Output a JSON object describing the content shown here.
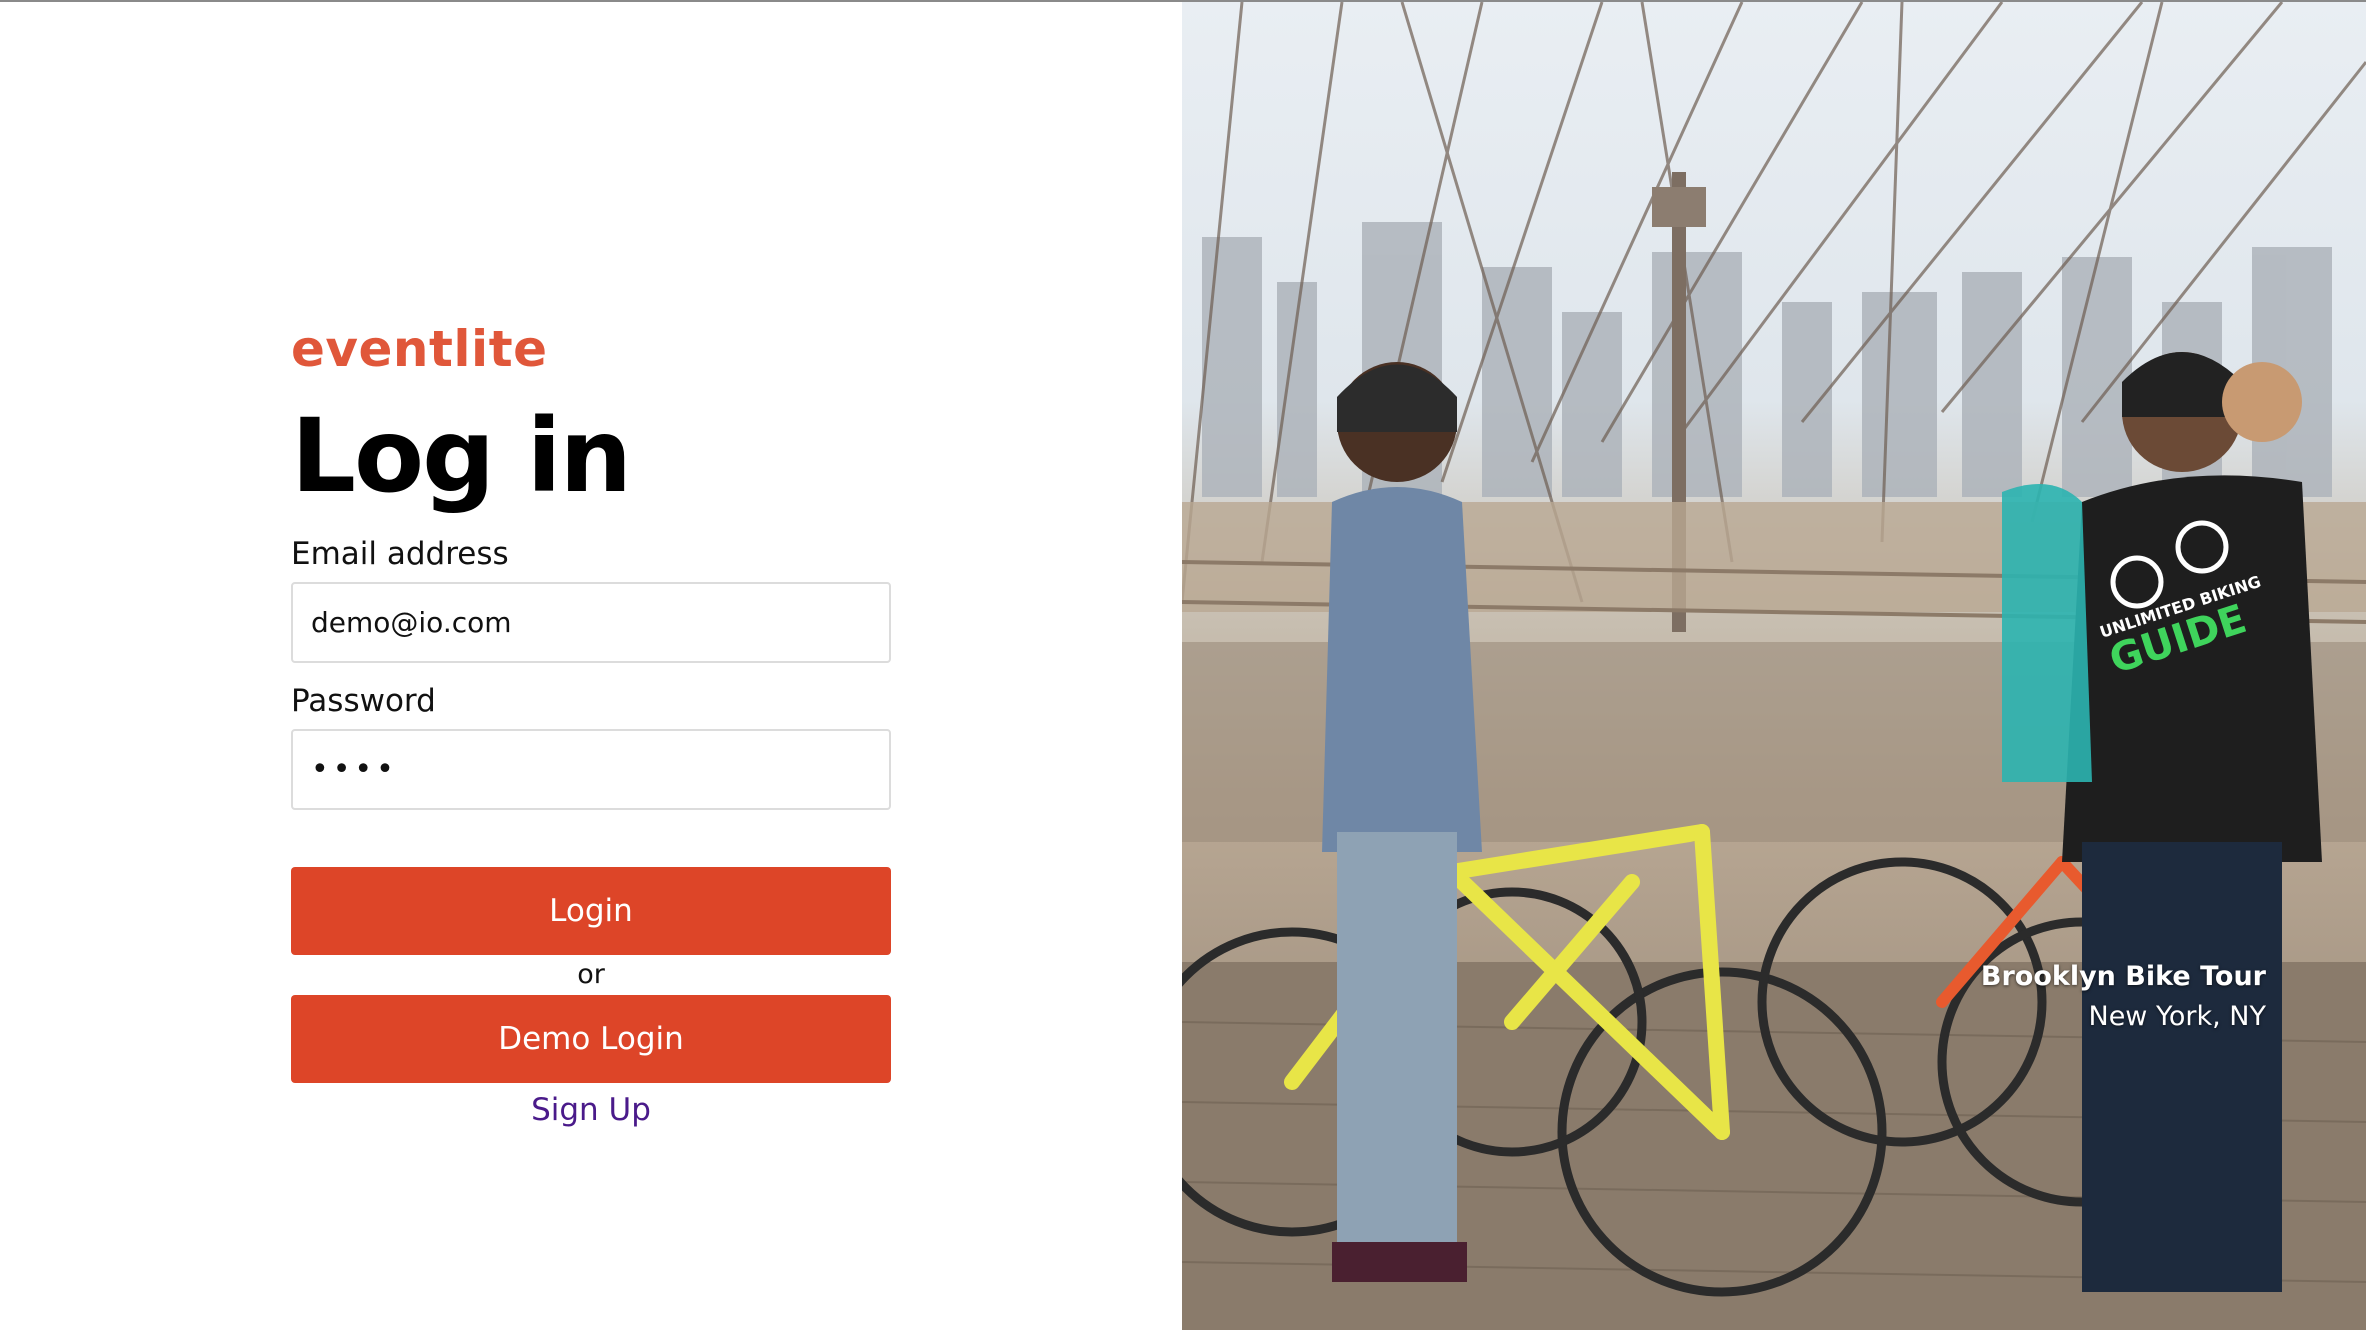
{
  "brand": "eventlite",
  "page_title": "Log in",
  "form": {
    "email_label": "Email address",
    "email_value": "demo@io.com",
    "password_label": "Password",
    "password_value": "demo"
  },
  "buttons": {
    "login_label": "Login",
    "or_text": "or",
    "demo_login_label": "Demo Login",
    "signup_label": "Sign Up"
  },
  "photo": {
    "place": "Brooklyn Bike Tour",
    "city": "New York, NY",
    "jersey_text": "UNLIMITED BIKING",
    "jersey_big": "GUIDE"
  },
  "colors": {
    "brand": "#e0573a",
    "button": "#dd4528",
    "link": "#4a1a8a"
  }
}
